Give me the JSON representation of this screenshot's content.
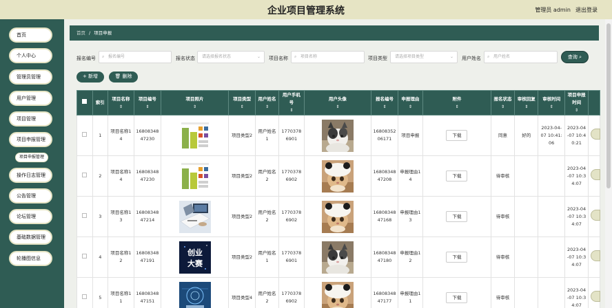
{
  "header": {
    "title": "企业项目管理系统",
    "user": "管理员 admin",
    "logout": "退出登录"
  },
  "sidebar": {
    "items": [
      {
        "label": "首页",
        "has_chevron": false
      },
      {
        "label": "个人中心",
        "has_chevron": true
      },
      {
        "label": "管理员管理",
        "has_chevron": true
      },
      {
        "label": "用户管理",
        "has_chevron": true
      },
      {
        "label": "项目管理",
        "has_chevron": true
      },
      {
        "label": "项目申报管理",
        "has_chevron": true
      },
      {
        "label": "操作日志管理",
        "has_chevron": true
      },
      {
        "label": "公告管理",
        "has_chevron": true
      },
      {
        "label": "论坛管理",
        "has_chevron": true
      },
      {
        "label": "基础数据管理",
        "has_chevron": true
      },
      {
        "label": "轮播图信息",
        "has_chevron": true
      }
    ],
    "subitem": "项目申报管理",
    "chevron": "⌄"
  },
  "breadcrumb": {
    "home": "首页",
    "separator": "/",
    "current": "项目申报"
  },
  "search": {
    "fields": [
      {
        "label": "报名编号",
        "placeholder": "报名编号",
        "type": "input"
      },
      {
        "label": "报名状态",
        "placeholder": "请选择报名状态",
        "type": "select"
      },
      {
        "label": "项目名称",
        "placeholder": "项目名称",
        "type": "input"
      },
      {
        "label": "项目类型",
        "placeholder": "请选择项目类型",
        "type": "select"
      },
      {
        "label": "用户姓名",
        "placeholder": "用户姓名",
        "type": "input"
      }
    ],
    "query_label": "查询 ⌕"
  },
  "actions": {
    "new_label": "+ 新增",
    "delete_label": "🗑 删除"
  },
  "table": {
    "sort_glyph": "⇕",
    "columns": [
      "",
      "索引",
      "项目名称",
      "项目编号",
      "项目照片",
      "项目类型",
      "用户姓名",
      "用户手机号",
      "用户头像",
      "报名编号",
      "申报理由",
      "附件",
      "报名状态",
      "审核回复",
      "审核时间",
      "项目申报时间",
      ""
    ],
    "sortable": [
      false,
      false,
      true,
      true,
      true,
      true,
      true,
      true,
      true,
      true,
      true,
      true,
      true,
      true,
      true,
      true,
      false
    ],
    "download_label": "下载",
    "rows": [
      {
        "index": "1",
        "project_name": "项目名称14",
        "project_no": "1680834847230",
        "photo": "chart",
        "type": "项目类型2",
        "user_name": "用户姓名1",
        "phone": "17703786901",
        "avatar": "cat1",
        "apply_no": "1680835206171",
        "reason": "项目申报",
        "status": "同意",
        "reply": "好的",
        "review_time": "2023-04-07 10:41:06",
        "apply_time": "2023-04-07 10:40:21"
      },
      {
        "index": "2",
        "project_name": "项目名称14",
        "project_no": "1680834847230",
        "photo": "chart",
        "type": "项目类型2",
        "user_name": "用户姓名2",
        "phone": "17703786902",
        "avatar": "cat2",
        "apply_no": "1680834847208",
        "reason": "申报理由14",
        "status": "待审核",
        "reply": "",
        "review_time": "",
        "apply_time": "2023-04-07 10:34:07"
      },
      {
        "index": "3",
        "project_name": "项目名称13",
        "project_no": "1680834847214",
        "photo": "office",
        "type": "项目类型2",
        "user_name": "用户姓名2",
        "phone": "17703786902",
        "avatar": "cat2",
        "apply_no": "1680834847168",
        "reason": "申报理由13",
        "status": "待审核",
        "reply": "",
        "review_time": "",
        "apply_time": "2023-04-07 10:34:07"
      },
      {
        "index": "4",
        "project_name": "项目名称12",
        "project_no": "1680834847191",
        "photo": "contest",
        "type": "项目类型2",
        "user_name": "用户姓名1",
        "phone": "17703786901",
        "avatar": "cat1",
        "apply_no": "1680834847180",
        "reason": "申报理由12",
        "status": "待审核",
        "reply": "",
        "review_time": "",
        "apply_time": "2023-04-07 10:34:07"
      },
      {
        "index": "5",
        "project_name": "项目名称11",
        "project_no": "1680834847151",
        "photo": "tech",
        "type": "项目类型4",
        "user_name": "用户姓名2",
        "phone": "17703786902",
        "avatar": "cat2",
        "apply_no": "1680834847177",
        "reason": "申报理由11",
        "status": "待审核",
        "reply": "",
        "review_time": "",
        "apply_time": "2023-04-07 10:34:07"
      }
    ],
    "contest_text": [
      "创业",
      "大赛"
    ]
  },
  "colors": {
    "accent": "#2f5c54",
    "header_bg": "#e6e4c4",
    "page_bg": "#eef0eb"
  }
}
